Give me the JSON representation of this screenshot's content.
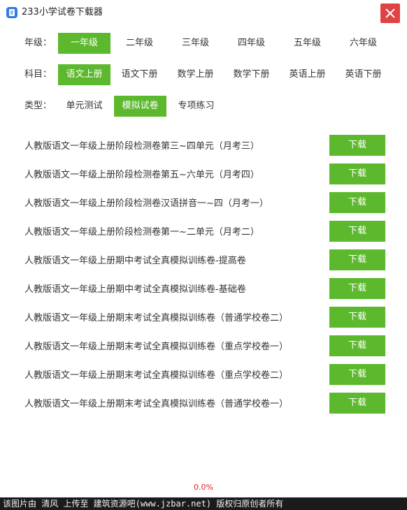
{
  "window": {
    "title": "233小学试卷下载器"
  },
  "grade": {
    "label": "年级：",
    "options": [
      "一年级",
      "二年级",
      "三年级",
      "四年级",
      "五年级",
      "六年级"
    ],
    "selected": "一年级"
  },
  "subject": {
    "label": "科目：",
    "options": [
      "语文上册",
      "语文下册",
      "数学上册",
      "数学下册",
      "英语上册",
      "英语下册"
    ],
    "selected": "语文上册"
  },
  "type": {
    "label": "类型：",
    "options": [
      "单元测试",
      "模拟试卷",
      "专项练习"
    ],
    "selected": "模拟试卷"
  },
  "papers": [
    {
      "title": "人教版语文一年级上册阶段检测卷第三~四单元（月考三）",
      "button": "下载"
    },
    {
      "title": "人教版语文一年级上册阶段检测卷第五~六单元（月考四）",
      "button": "下载"
    },
    {
      "title": "人教版语文一年级上册阶段检测卷汉语拼音一~四（月考一）",
      "button": "下载"
    },
    {
      "title": "人教版语文一年级上册阶段检测卷第一~二单元（月考二）",
      "button": "下载"
    },
    {
      "title": "人教版语文一年级上册期中考试全真模拟训练卷-提高卷",
      "button": "下载"
    },
    {
      "title": "人教版语文一年级上册期中考试全真模拟训练卷-基础卷",
      "button": "下载"
    },
    {
      "title": "人教版语文一年级上册期末考试全真模拟训练卷（普通学校卷二）",
      "button": "下载"
    },
    {
      "title": "人教版语文一年级上册期末考试全真模拟训练卷（重点学校卷一）",
      "button": "下载"
    },
    {
      "title": "人教版语文一年级上册期末考试全真模拟训练卷（重点学校卷二）",
      "button": "下载"
    },
    {
      "title": "人教版语文一年级上册期末考试全真模拟训练卷（普通学校卷一）",
      "button": "下载"
    }
  ],
  "progress": "0.0%",
  "footer": "该图片由 清风 上传至 建筑资源吧(www.jzbar.net) 版权归原创者所有",
  "colors": {
    "accent": "#5cb82c",
    "close": "#e04343",
    "progress": "#e02020"
  },
  "icons": {
    "app": "app-logo-icon",
    "close": "close-icon"
  }
}
